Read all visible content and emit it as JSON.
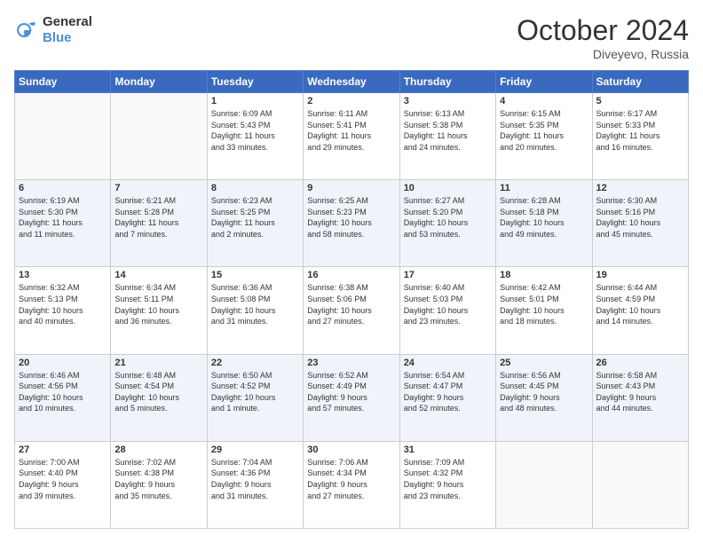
{
  "logo": {
    "line1": "General",
    "line2": "Blue"
  },
  "header": {
    "month": "October 2024",
    "location": "Diveyevo, Russia"
  },
  "weekdays": [
    "Sunday",
    "Monday",
    "Tuesday",
    "Wednesday",
    "Thursday",
    "Friday",
    "Saturday"
  ],
  "rows": [
    {
      "shade": "white",
      "cells": [
        {
          "day": "",
          "info": ""
        },
        {
          "day": "",
          "info": ""
        },
        {
          "day": "1",
          "info": "Sunrise: 6:09 AM\nSunset: 5:43 PM\nDaylight: 11 hours\nand 33 minutes."
        },
        {
          "day": "2",
          "info": "Sunrise: 6:11 AM\nSunset: 5:41 PM\nDaylight: 11 hours\nand 29 minutes."
        },
        {
          "day": "3",
          "info": "Sunrise: 6:13 AM\nSunset: 5:38 PM\nDaylight: 11 hours\nand 24 minutes."
        },
        {
          "day": "4",
          "info": "Sunrise: 6:15 AM\nSunset: 5:35 PM\nDaylight: 11 hours\nand 20 minutes."
        },
        {
          "day": "5",
          "info": "Sunrise: 6:17 AM\nSunset: 5:33 PM\nDaylight: 11 hours\nand 16 minutes."
        }
      ]
    },
    {
      "shade": "shaded",
      "cells": [
        {
          "day": "6",
          "info": "Sunrise: 6:19 AM\nSunset: 5:30 PM\nDaylight: 11 hours\nand 11 minutes."
        },
        {
          "day": "7",
          "info": "Sunrise: 6:21 AM\nSunset: 5:28 PM\nDaylight: 11 hours\nand 7 minutes."
        },
        {
          "day": "8",
          "info": "Sunrise: 6:23 AM\nSunset: 5:25 PM\nDaylight: 11 hours\nand 2 minutes."
        },
        {
          "day": "9",
          "info": "Sunrise: 6:25 AM\nSunset: 5:23 PM\nDaylight: 10 hours\nand 58 minutes."
        },
        {
          "day": "10",
          "info": "Sunrise: 6:27 AM\nSunset: 5:20 PM\nDaylight: 10 hours\nand 53 minutes."
        },
        {
          "day": "11",
          "info": "Sunrise: 6:28 AM\nSunset: 5:18 PM\nDaylight: 10 hours\nand 49 minutes."
        },
        {
          "day": "12",
          "info": "Sunrise: 6:30 AM\nSunset: 5:16 PM\nDaylight: 10 hours\nand 45 minutes."
        }
      ]
    },
    {
      "shade": "white",
      "cells": [
        {
          "day": "13",
          "info": "Sunrise: 6:32 AM\nSunset: 5:13 PM\nDaylight: 10 hours\nand 40 minutes."
        },
        {
          "day": "14",
          "info": "Sunrise: 6:34 AM\nSunset: 5:11 PM\nDaylight: 10 hours\nand 36 minutes."
        },
        {
          "day": "15",
          "info": "Sunrise: 6:36 AM\nSunset: 5:08 PM\nDaylight: 10 hours\nand 31 minutes."
        },
        {
          "day": "16",
          "info": "Sunrise: 6:38 AM\nSunset: 5:06 PM\nDaylight: 10 hours\nand 27 minutes."
        },
        {
          "day": "17",
          "info": "Sunrise: 6:40 AM\nSunset: 5:03 PM\nDaylight: 10 hours\nand 23 minutes."
        },
        {
          "day": "18",
          "info": "Sunrise: 6:42 AM\nSunset: 5:01 PM\nDaylight: 10 hours\nand 18 minutes."
        },
        {
          "day": "19",
          "info": "Sunrise: 6:44 AM\nSunset: 4:59 PM\nDaylight: 10 hours\nand 14 minutes."
        }
      ]
    },
    {
      "shade": "shaded",
      "cells": [
        {
          "day": "20",
          "info": "Sunrise: 6:46 AM\nSunset: 4:56 PM\nDaylight: 10 hours\nand 10 minutes."
        },
        {
          "day": "21",
          "info": "Sunrise: 6:48 AM\nSunset: 4:54 PM\nDaylight: 10 hours\nand 5 minutes."
        },
        {
          "day": "22",
          "info": "Sunrise: 6:50 AM\nSunset: 4:52 PM\nDaylight: 10 hours\nand 1 minute."
        },
        {
          "day": "23",
          "info": "Sunrise: 6:52 AM\nSunset: 4:49 PM\nDaylight: 9 hours\nand 57 minutes."
        },
        {
          "day": "24",
          "info": "Sunrise: 6:54 AM\nSunset: 4:47 PM\nDaylight: 9 hours\nand 52 minutes."
        },
        {
          "day": "25",
          "info": "Sunrise: 6:56 AM\nSunset: 4:45 PM\nDaylight: 9 hours\nand 48 minutes."
        },
        {
          "day": "26",
          "info": "Sunrise: 6:58 AM\nSunset: 4:43 PM\nDaylight: 9 hours\nand 44 minutes."
        }
      ]
    },
    {
      "shade": "white",
      "cells": [
        {
          "day": "27",
          "info": "Sunrise: 7:00 AM\nSunset: 4:40 PM\nDaylight: 9 hours\nand 39 minutes."
        },
        {
          "day": "28",
          "info": "Sunrise: 7:02 AM\nSunset: 4:38 PM\nDaylight: 9 hours\nand 35 minutes."
        },
        {
          "day": "29",
          "info": "Sunrise: 7:04 AM\nSunset: 4:36 PM\nDaylight: 9 hours\nand 31 minutes."
        },
        {
          "day": "30",
          "info": "Sunrise: 7:06 AM\nSunset: 4:34 PM\nDaylight: 9 hours\nand 27 minutes."
        },
        {
          "day": "31",
          "info": "Sunrise: 7:09 AM\nSunset: 4:32 PM\nDaylight: 9 hours\nand 23 minutes."
        },
        {
          "day": "",
          "info": ""
        },
        {
          "day": "",
          "info": ""
        }
      ]
    }
  ]
}
